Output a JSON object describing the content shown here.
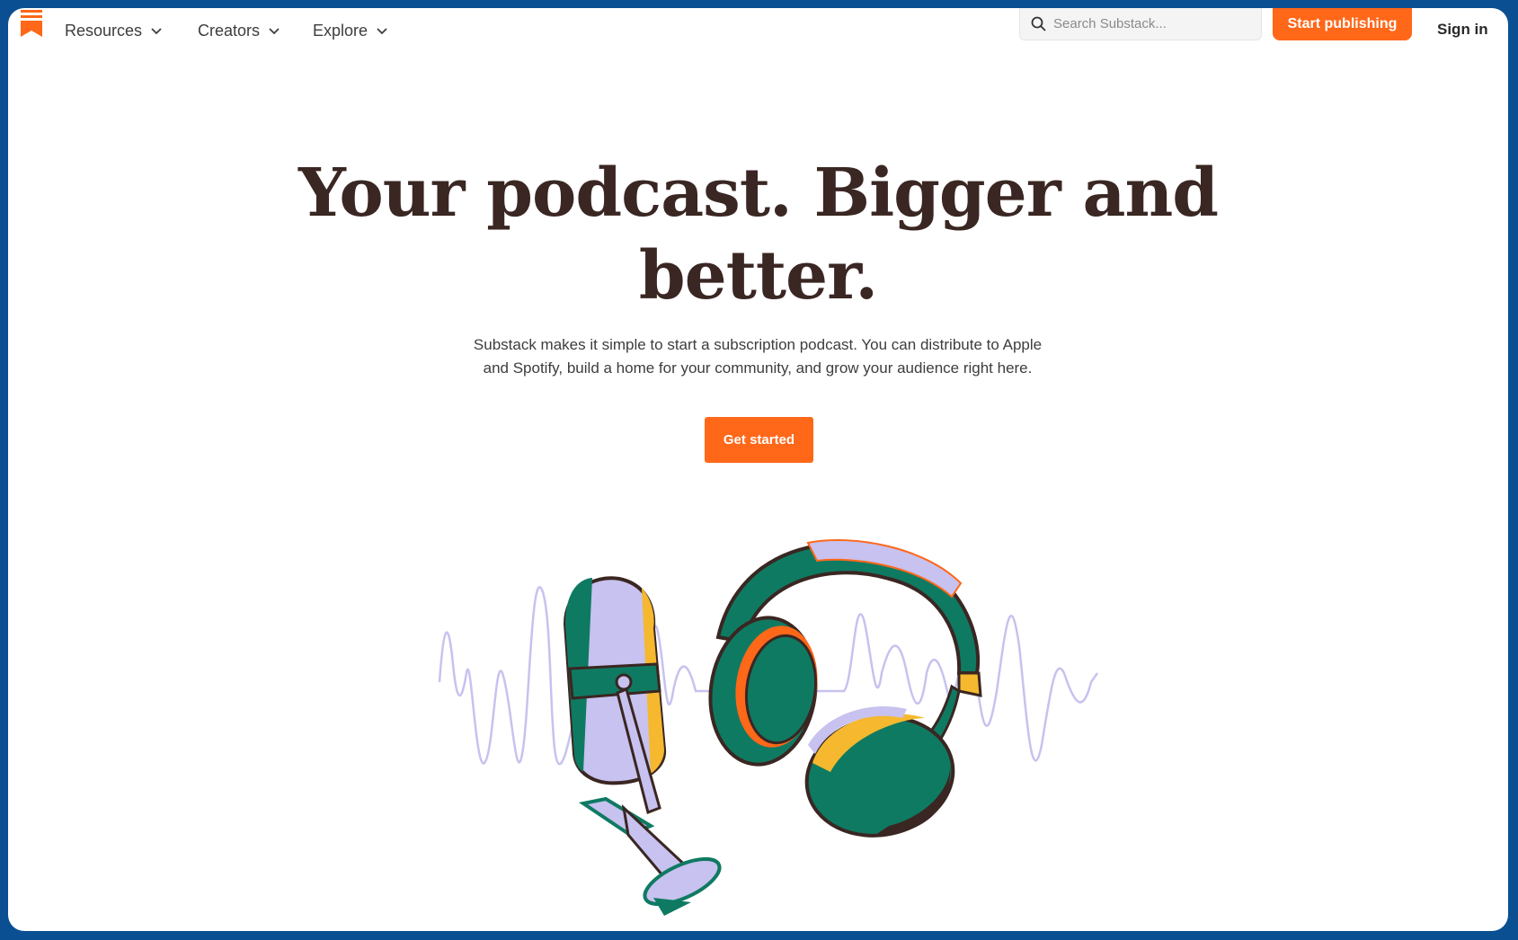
{
  "nav": {
    "items": [
      {
        "label": "Resources"
      },
      {
        "label": "Creators"
      },
      {
        "label": "Explore"
      }
    ],
    "search_placeholder": "Search Substack...",
    "start_publishing": "Start publishing",
    "sign_in": "Sign in"
  },
  "hero": {
    "title_line1": "Your podcast. Bigger and",
    "title_line2": "better.",
    "subtitle_line1": "Substack makes it simple to start a subscription podcast. You can distribute to Apple",
    "subtitle_line2": "and Spotify, build a home for your community, and grow your audience right here.",
    "cta": "Get started"
  },
  "colors": {
    "brand_orange": "#ff6719",
    "frame_blue": "#0b4f93",
    "title_brown": "#3a2622",
    "illustration_green": "#0f7a62",
    "illustration_lavender": "#c7c2ef"
  },
  "icons": {
    "logo": "substack-bookmark-logo",
    "search": "search-icon",
    "chevron": "chevron-down-icon"
  }
}
